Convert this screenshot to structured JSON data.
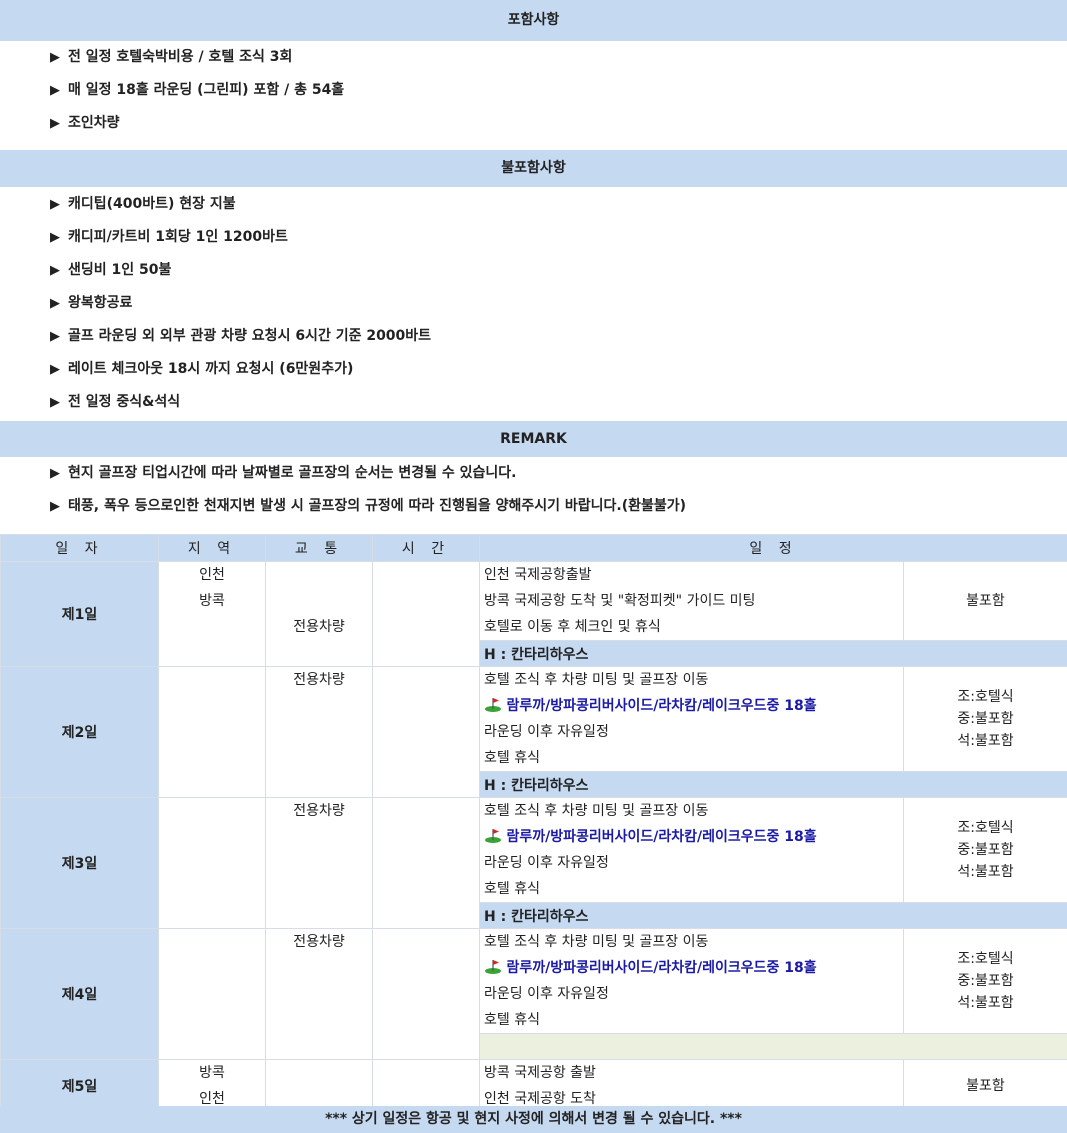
{
  "included": {
    "title": "포함사항",
    "items": [
      "전 일정 호텔숙박비용 / 호텔 조식 3회",
      "매 일정 18홀 라운딩 (그린피) 포함 / 총 54홀",
      "조인차량"
    ]
  },
  "excluded": {
    "title": "불포함사항",
    "items": [
      "캐디팁(400바트) 현장 지불",
      "캐디피/카트비 1회당 1인 1200바트",
      "샌딩비 1인 50불",
      "왕복항공료",
      "골프 라운딩 외 외부 관광 차량 요청시 6시간 기준 2000바트",
      "레이트 체크아웃 18시 까지 요청시 (6만원추가)",
      "전 일정 중식&석식"
    ]
  },
  "remark": {
    "title": "REMARK",
    "items": [
      "현지 골프장 티업시간에 따라 날짜별로 골프장의 순서는 변경될 수 있습니다.",
      "태풍, 폭우 등으로인한 천재지변 발생 시 골프장의 규정에 따라 진행됨을 양해주시기 바랍니다.(환불불가)"
    ]
  },
  "bullet_glyph": "▶",
  "table": {
    "headers": [
      "일 자",
      "지 역",
      "교 통",
      "시 간",
      "일 정"
    ],
    "days": [
      {
        "day": "제1일",
        "region": [
          "인천",
          "방콕"
        ],
        "transport": "전용차량",
        "lines": [
          "인천 국제공항출발",
          "방콕 국제공항 도착 및 \"확정피켓\" 가이드 미팅",
          "호텔로 이동 후 체크인 및 휴식"
        ],
        "meals": [
          "불포함"
        ],
        "hotel": "H : 칸타리하우스"
      },
      {
        "day": "제2일",
        "transport": "전용차량",
        "lines": [
          "호텔 조식 후 차량 미팅 및 골프장 이동",
          "람루까/방파콩리버사이드/라차캄/레이크우드중 18홀",
          "라운딩 이후 자유일정",
          "호텔 휴식"
        ],
        "meals": [
          "조:호텔식",
          "중:불포함",
          "석:불포함"
        ],
        "hotel": "H : 칸타리하우스"
      },
      {
        "day": "제3일",
        "transport": "전용차량",
        "lines": [
          "호텔 조식 후 차량 미팅 및 골프장 이동",
          "람루까/방파콩리버사이드/라차캄/레이크우드중 18홀",
          "라운딩 이후 자유일정",
          "호텔 휴식"
        ],
        "meals": [
          "조:호텔식",
          "중:불포함",
          "석:불포함"
        ],
        "hotel": "H : 칸타리하우스"
      },
      {
        "day": "제4일",
        "transport": "전용차량",
        "lines": [
          "호텔 조식 후 차량 미팅 및 골프장 이동",
          "람루까/방파콩리버사이드/라차캄/레이크우드중 18홀",
          "라운딩 이후 자유일정",
          "호텔 휴식"
        ],
        "meals": [
          "조:호텔식",
          "중:불포함",
          "석:불포함"
        ]
      },
      {
        "day": "제5일",
        "region": [
          "방콕",
          "인천"
        ],
        "lines": [
          "방콕 국제공항 출발",
          "인천 국제공항 도착"
        ],
        "meals": [
          "불포함"
        ]
      }
    ]
  },
  "footer": "*** 상기 일정은 항공 및 현지 사정에 의해서 변경 될 수 있습니다. ***",
  "colors": {
    "header_bg": "#c5d9f1",
    "golf_text": "#1a1aa6",
    "empty_row_bg": "#ebf1de"
  }
}
